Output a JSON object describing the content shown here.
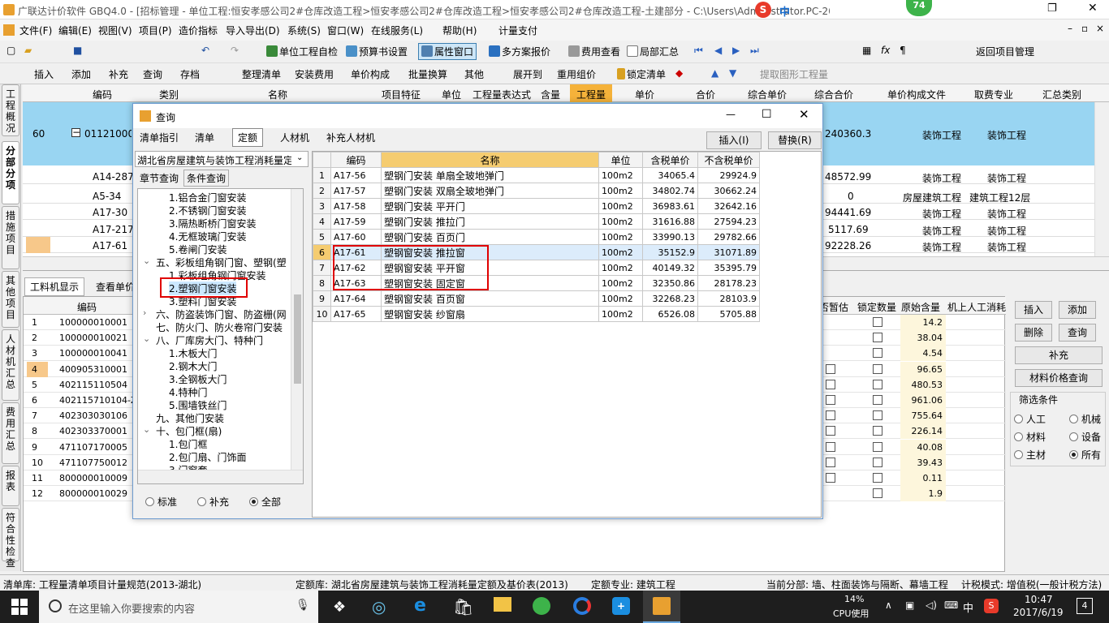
{
  "window": {
    "title": "广联达计价软件 GBQ4.0 - [招标管理 - 单位工程:恒安孝感公司2#仓库改造工程>恒安孝感公司2#仓库改造工程>恒安孝感公司2#仓库改造工程-土建部分 - C:\\Users\\Administrator.PC-20141127NRHM\\De...\\恒安孝感公..."
  },
  "ime": {
    "badge": "74",
    "label": "中"
  },
  "menu": [
    "文件(F)",
    "编辑(E)",
    "视图(V)",
    "项目(P)",
    "造价指标",
    "导入导出(D)",
    "系统(S)",
    "窗口(W)",
    "在线服务(L)",
    "帮助(H)",
    "计量支付"
  ],
  "toolbar1": [
    "单位工程自检",
    "预算书设置",
    "属性窗口",
    "多方案报价",
    "费用查看",
    "局部汇总",
    "返回项目管理"
  ],
  "toolbar2": [
    "插入",
    "添加",
    "补充",
    "查询",
    "存档",
    "整理清单",
    "安装费用",
    "单价构成",
    "批量换算",
    "其他",
    "展开到",
    "重用组价",
    "锁定清单",
    "提取图形工程量"
  ],
  "left_tabs": [
    "工程概况",
    "分部分项",
    "措施项目",
    "其他项目",
    "人材机汇总",
    "费用汇总",
    "报表",
    "符合性检查"
  ],
  "main_grid": {
    "headers": [
      "编码",
      "类别",
      "名称",
      "项目特征",
      "单位",
      "工程量表达式",
      "含量",
      "工程量",
      "单价",
      "合价",
      "综合单价",
      "综合合价",
      "单价构成文件",
      "取费专业",
      "汇总类别"
    ],
    "row60": {
      "no": "60",
      "code": "01121000​50",
      "total": "240360.3",
      "file": "装饰工程",
      "fee": "装饰工程"
    },
    "subrows": [
      {
        "code": "A14-287",
        "total": "48572.99",
        "file": "装饰工程",
        "fee": "装饰工程"
      },
      {
        "code": "A5-34",
        "total": "0",
        "file": "房屋建筑工程",
        "fee": "建筑工程12层"
      },
      {
        "code": "A17-30",
        "total": "94441.69",
        "file": "装饰工程",
        "fee": "装饰工程"
      },
      {
        "code": "A17-217",
        "total": "5117.69",
        "file": "装饰工程",
        "fee": "装饰工程"
      },
      {
        "code": "A17-61",
        "total": "92228.26",
        "file": "装饰工程",
        "fee": "装饰工程"
      }
    ]
  },
  "lower_tabs": [
    "工料机显示",
    "查看单价"
  ],
  "lower_grid": {
    "code_header": "编码",
    "headers_right": [
      "否暂估",
      "锁定数量",
      "原始含量",
      "机上人工消耗"
    ],
    "rows": [
      {
        "no": "1",
        "code": "100000010001",
        "qty": "14.2"
      },
      {
        "no": "2",
        "code": "100000010021",
        "qty": "38.04"
      },
      {
        "no": "3",
        "code": "100000010041",
        "qty": "4.54"
      },
      {
        "no": "4",
        "code": "400905310001",
        "qty": "96.65"
      },
      {
        "no": "5",
        "code": "402115110504",
        "qty": "480.53"
      },
      {
        "no": "6",
        "code": "402115710104-Z",
        "qty": "961.06"
      },
      {
        "no": "7",
        "code": "402303030106",
        "qty": "755.64"
      },
      {
        "no": "8",
        "code": "402303370001",
        "qty": "226.14"
      },
      {
        "no": "9",
        "code": "471107170005",
        "qty": "40.08"
      },
      {
        "no": "10",
        "code": "471107750012",
        "qty": "39.43"
      },
      {
        "no": "11",
        "code": "800000010009",
        "qty": "0.11"
      },
      {
        "no": "12",
        "code": "800000010029",
        "qty": "1.9"
      }
    ]
  },
  "side_panel": {
    "buttons": [
      "插入",
      "添加",
      "删除",
      "查询",
      "补充",
      "材料价格查询"
    ],
    "filter_title": "筛选条件",
    "filters": [
      "人工",
      "机械",
      "材料",
      "设备",
      "主材",
      "所有"
    ]
  },
  "dialog": {
    "title": "查询",
    "tabs": [
      "清单指引",
      "清单",
      "定额",
      "人材机",
      "补充人材机"
    ],
    "insert_btn": "插入(I)",
    "replace_btn": "替换(R)",
    "library": "湖北省房屋建筑与装饰工程消耗量定",
    "subtabs": [
      "章节查询",
      "条件查询"
    ],
    "tree": [
      "1.铝合金门窗安装",
      "2.不锈钢门窗安装",
      "3.隔热断桥门窗安装",
      "4.无框玻璃门安装",
      "5.卷闸门安装",
      "五、彩板组角钢门窗、塑钢(塑",
      "1.彩板组角钢门窗安装",
      "2.塑钢门窗安装",
      "3.塑料门窗安装",
      "六、防盗装饰门窗、防盗栅(网",
      "七、防火门、防火卷帘门安装",
      "八、厂库房大门、特种门",
      "1.木板大门",
      "2.钢木大门",
      "3.全钢板大门",
      "4.特种门",
      "5.围墙铁丝门",
      "九、其他门安装",
      "十、包门框(扇)",
      "1.包门框",
      "2.包门扇、门饰面",
      "3.门窗套"
    ],
    "radios": [
      "标准",
      "补充",
      "全部"
    ],
    "table_headers": [
      "编码",
      "名称",
      "单位",
      "含税单价",
      "不含税单价"
    ],
    "rows": [
      {
        "no": "1",
        "code": "A17-56",
        "name": "塑钢门安装 单扇全玻地弹门",
        "unit": "100m2",
        "price": "34065.4",
        "net": "29924.9"
      },
      {
        "no": "2",
        "code": "A17-57",
        "name": "塑钢门安装 双扇全玻地弹门",
        "unit": "100m2",
        "price": "34802.74",
        "net": "30662.24"
      },
      {
        "no": "3",
        "code": "A17-58",
        "name": "塑钢门安装 平开门",
        "unit": "100m2",
        "price": "36983.61",
        "net": "32642.16"
      },
      {
        "no": "4",
        "code": "A17-59",
        "name": "塑钢门安装 推拉门",
        "unit": "100m2",
        "price": "31616.88",
        "net": "27594.23"
      },
      {
        "no": "5",
        "code": "A17-60",
        "name": "塑钢门安装 百页门",
        "unit": "100m2",
        "price": "33990.13",
        "net": "29782.66"
      },
      {
        "no": "6",
        "code": "A17-61",
        "name": "塑钢窗安装 推拉窗",
        "unit": "100m2",
        "price": "35152.9",
        "net": "31071.89"
      },
      {
        "no": "7",
        "code": "A17-62",
        "name": "塑钢窗安装 平开窗",
        "unit": "100m2",
        "price": "40149.32",
        "net": "35395.79"
      },
      {
        "no": "8",
        "code": "A17-63",
        "name": "塑钢窗安装 固定窗",
        "unit": "100m2",
        "price": "32350.86",
        "net": "28178.23"
      },
      {
        "no": "9",
        "code": "A17-64",
        "name": "塑钢窗安装 百页窗",
        "unit": "100m2",
        "price": "32268.23",
        "net": "28103.9"
      },
      {
        "no": "10",
        "code": "A17-65",
        "name": "塑钢窗安装 纱窗扇",
        "unit": "100m2",
        "price": "6526.08",
        "net": "5705.88"
      }
    ]
  },
  "status": {
    "list_lib": "清单库:  工程量清单项目计量规范(2013-湖北)",
    "quota_lib": "定额库:  湖北省房屋建筑与装饰工程消耗量定额及基价表(2013)",
    "quota_major": "定额专业:  建筑工程",
    "current": "当前分部:  墙、柱面装饰与隔断、幕墙工程",
    "mode": "计税模式:  增值税(一般计税方法)"
  },
  "taskbar": {
    "search_placeholder": "在这里输入你要搜索的内容",
    "cpu_pct": "14%",
    "cpu_label": "CPU使用",
    "ime": "中",
    "time": "10:47",
    "date": "2017/6/19",
    "notif": "4"
  }
}
